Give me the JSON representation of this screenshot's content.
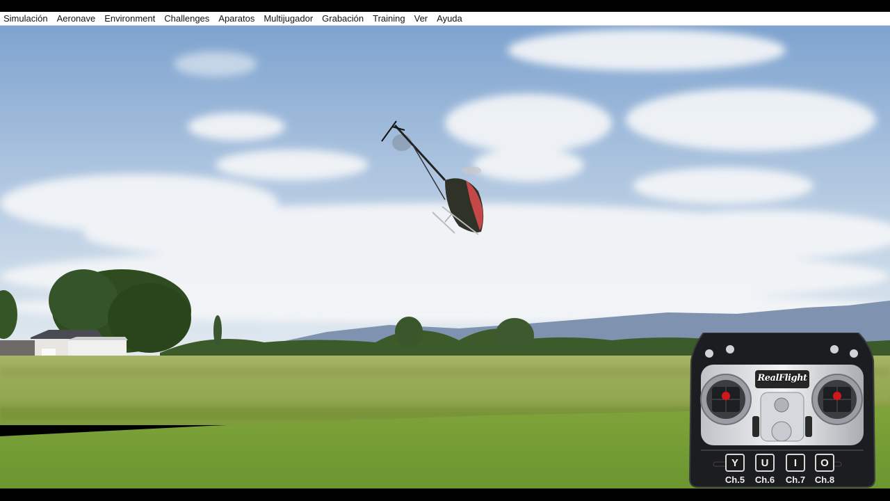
{
  "menubar": {
    "items": [
      {
        "label": "Simulación"
      },
      {
        "label": "Aeronave"
      },
      {
        "label": "Environment"
      },
      {
        "label": "Challenges"
      },
      {
        "label": "Aparatos"
      },
      {
        "label": "Multijugador"
      },
      {
        "label": "Grabación"
      },
      {
        "label": "Training"
      },
      {
        "label": "Ver"
      },
      {
        "label": "Ayuda"
      }
    ]
  },
  "transmitter": {
    "brand": "RealFlight",
    "switches": [
      {
        "key": "Y",
        "channel": "Ch.5"
      },
      {
        "key": "U",
        "channel": "Ch.6"
      },
      {
        "key": "I",
        "channel": "Ch.7"
      },
      {
        "key": "O",
        "channel": "Ch.8"
      }
    ]
  },
  "colors": {
    "sky_top": "#7ea3cf",
    "sky_bottom": "#d6e2ee",
    "grass": "#8fa44a",
    "stick_dot": "#d01818"
  }
}
